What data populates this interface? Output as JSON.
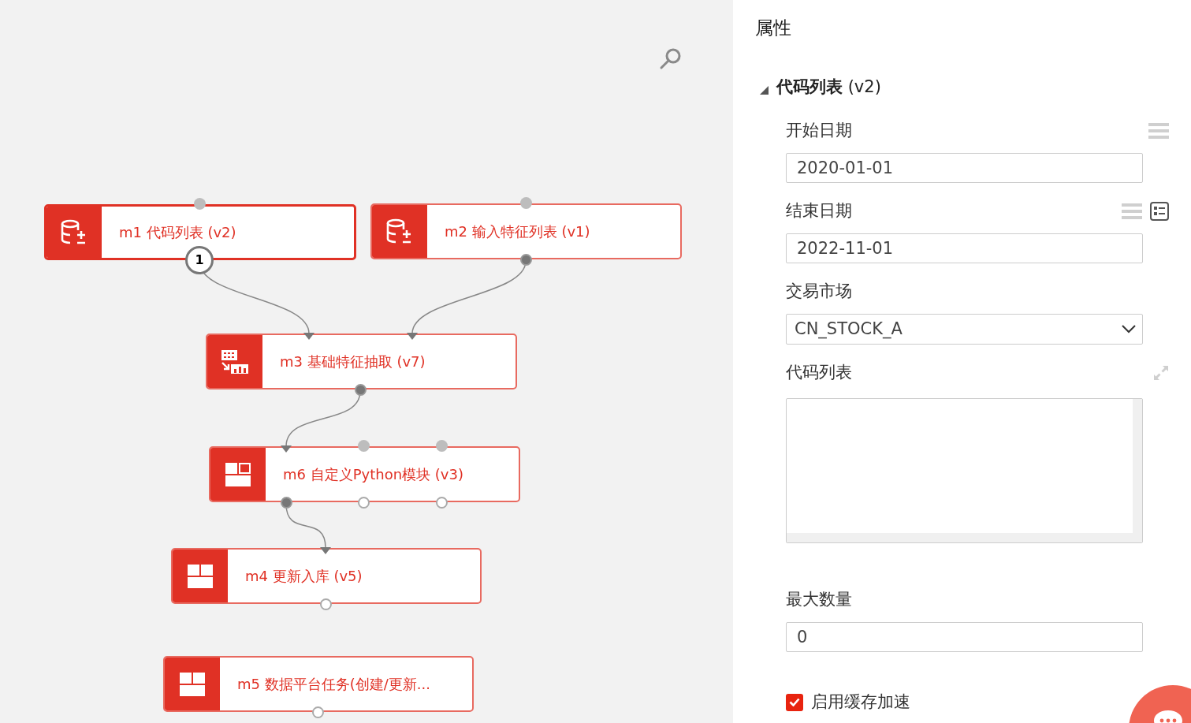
{
  "canvas": {
    "nodes": [
      {
        "label": "m1 代码列表 (v2)",
        "selected": true,
        "inputs": [
          {
            "kind": "empty"
          }
        ],
        "outputs": [
          {
            "kind": "badge",
            "badge": "1"
          }
        ]
      },
      {
        "label": "m2 输入特征列表 (v1)",
        "selected": false,
        "inputs": [
          {
            "kind": "empty"
          }
        ],
        "outputs": [
          {
            "kind": "filled"
          }
        ]
      },
      {
        "label": "m3 基础特征抽取 (v7)",
        "selected": false,
        "inputs": [
          {
            "kind": "arrow"
          },
          {
            "kind": "arrow"
          }
        ],
        "outputs": [
          {
            "kind": "filled"
          }
        ]
      },
      {
        "label": "m6 自定义Python模块 (v3)",
        "selected": false,
        "inputs": [
          {
            "kind": "arrow"
          },
          {
            "kind": "empty"
          },
          {
            "kind": "empty"
          }
        ],
        "outputs": [
          {
            "kind": "filled"
          },
          {
            "kind": "open"
          },
          {
            "kind": "open"
          }
        ]
      },
      {
        "label": "m4 更新入库 (v5)",
        "selected": false,
        "inputs": [
          {
            "kind": "arrow"
          }
        ],
        "outputs": [
          {
            "kind": "open"
          }
        ]
      },
      {
        "label": "m5 数据平台任务(创建/更新...",
        "selected": false,
        "outputs": [
          {
            "kind": "open"
          }
        ]
      }
    ]
  },
  "panel": {
    "title": "属性",
    "section": {
      "title": "**代码列表** (v2)",
      "expanded": true,
      "fields": [
        {
          "kind": "text",
          "label": "开始日期",
          "value": "2020-01-01"
        },
        {
          "kind": "text",
          "label": "结束日期",
          "value": "2022-11-01"
        },
        {
          "kind": "select",
          "label": "交易市场",
          "value": "CN_STOCK_A"
        },
        {
          "kind": "textarea",
          "label": "代码列表"
        },
        {
          "kind": "text",
          "label": "最大数量",
          "value": "0"
        },
        {
          "kind": "checkbox",
          "label": "启用缓存加速",
          "checked": true
        }
      ]
    }
  }
}
